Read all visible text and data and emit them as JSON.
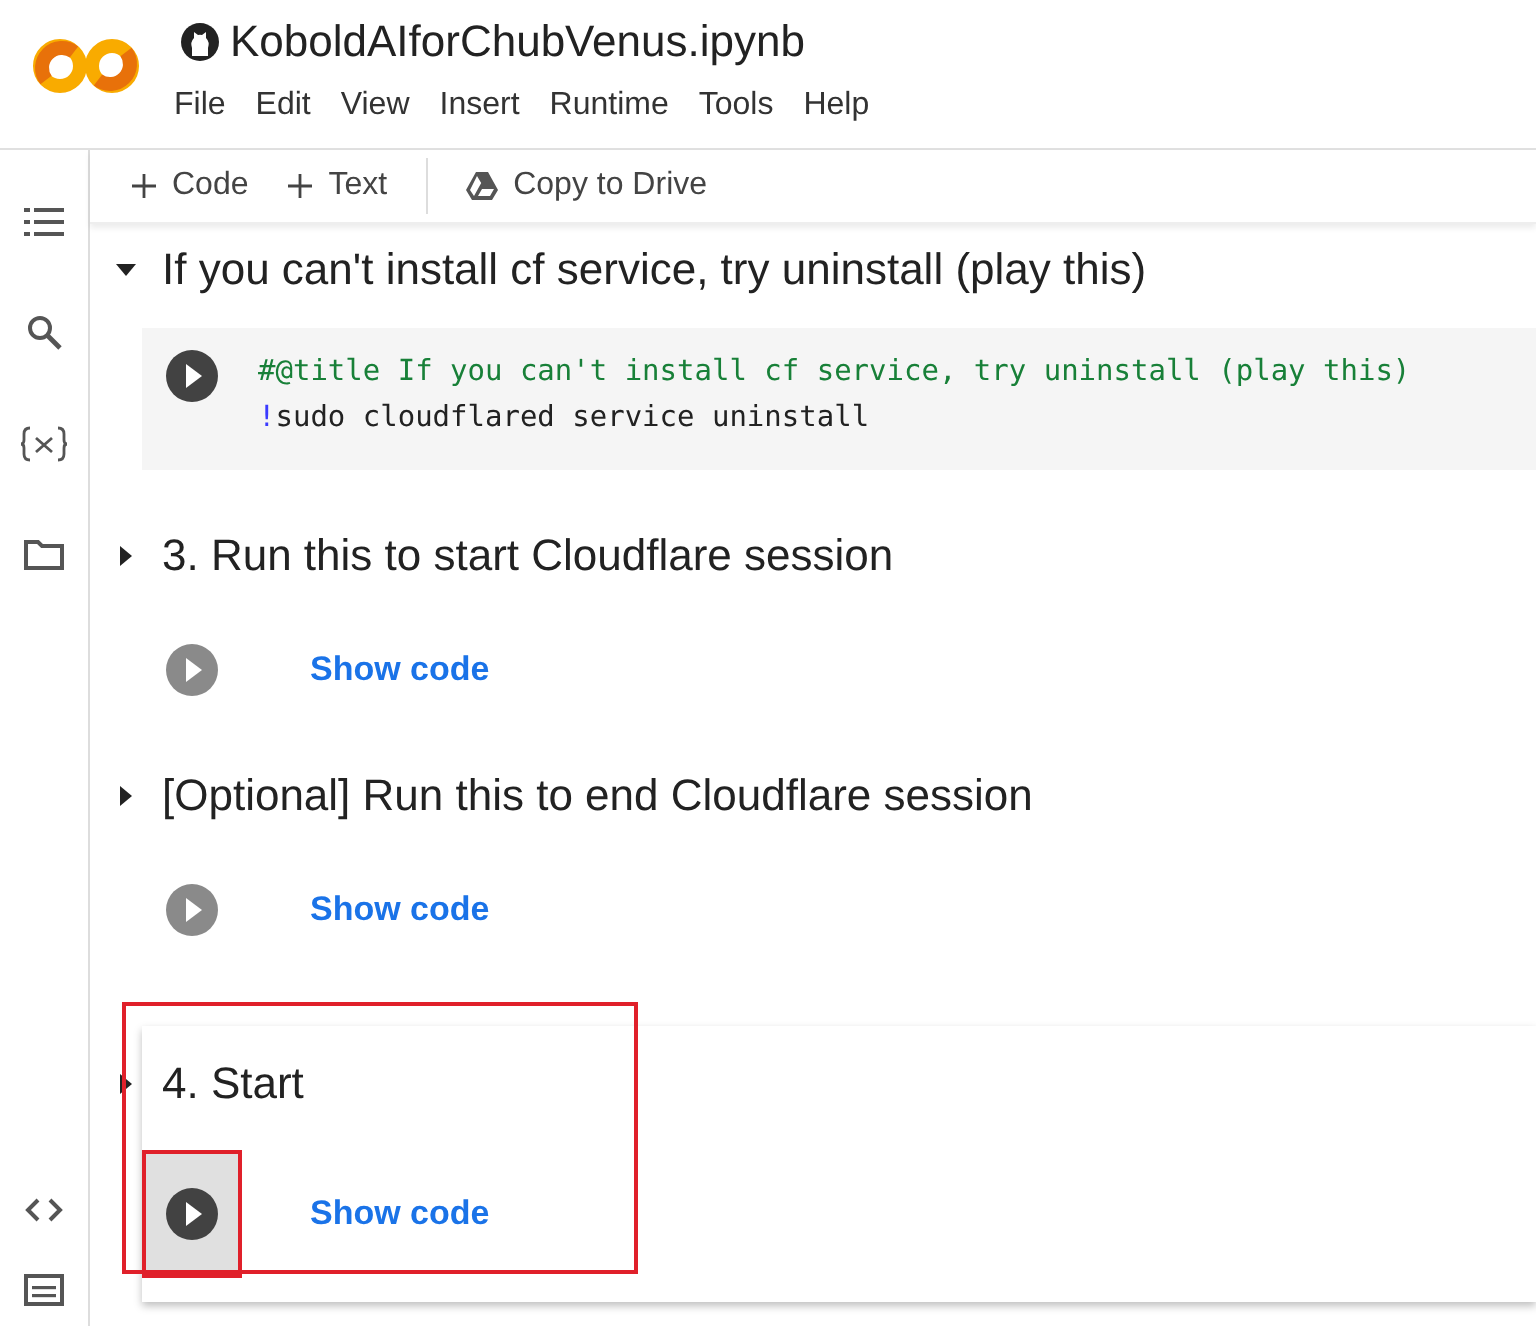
{
  "notebook": {
    "title": "KoboldAIforChubVenus.ipynb"
  },
  "menu": [
    "File",
    "Edit",
    "View",
    "Insert",
    "Runtime",
    "Tools",
    "Help"
  ],
  "toolbar": [
    {
      "kind": "add",
      "label": "Code"
    },
    {
      "kind": "add",
      "label": "Text"
    },
    {
      "kind": "drive",
      "label": "Copy to Drive"
    }
  ],
  "sections": [
    {
      "title": "If you can't install cf service, try uninstall (play this)",
      "expanded": true,
      "selected": false,
      "highlighted": false,
      "code": [
        {
          "kind": "comment",
          "text": "#@title If you can't install cf service, try uninstall (play this)"
        },
        {
          "kind": "shell",
          "bang": "!",
          "text": "sudo cloudflared service uninstall"
        }
      ]
    },
    {
      "title": "3. Run this to start Cloudflare session",
      "expanded": false,
      "selected": false,
      "highlighted": false,
      "link": "Show code"
    },
    {
      "title": "[Optional] Run this to end Cloudflare session",
      "expanded": false,
      "selected": false,
      "highlighted": false,
      "link": "Show code"
    },
    {
      "title": "4. Start",
      "expanded": false,
      "selected": true,
      "highlighted": true,
      "link": "Show code"
    }
  ]
}
